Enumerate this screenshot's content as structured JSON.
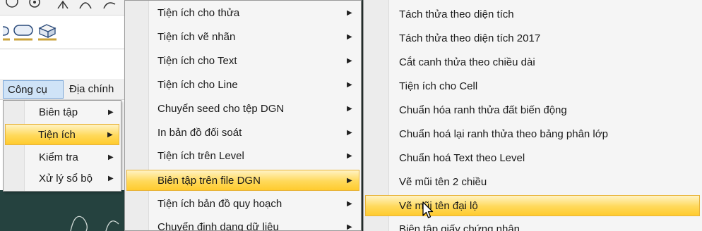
{
  "menubar": {
    "items": [
      {
        "label": "Công cụ"
      },
      {
        "label": "Địa chính"
      }
    ]
  },
  "menu_cong_cu": {
    "items": [
      {
        "label": "Biên tập",
        "has_submenu": true
      },
      {
        "label": "Tiện ích",
        "has_submenu": true,
        "highlighted": true
      },
      {
        "label": "Kiểm tra",
        "has_submenu": true
      },
      {
        "label": "Xử lý sổ bộ",
        "has_submenu": true
      }
    ]
  },
  "menu_tien_ich": {
    "items": [
      {
        "label": "Tiện ích cho thửa",
        "has_submenu": true
      },
      {
        "label": "Tiện ích vẽ nhãn",
        "has_submenu": true
      },
      {
        "label": "Tiện ích cho Text",
        "has_submenu": true
      },
      {
        "label": "Tiện ích cho Line",
        "has_submenu": true
      },
      {
        "label": "Chuyển seed cho tệp DGN",
        "has_submenu": true
      },
      {
        "label": "In bản đồ đối soát",
        "has_submenu": true
      },
      {
        "label": "Tiện ích trên Level",
        "has_submenu": true
      },
      {
        "label": "Biên tập trên file DGN",
        "has_submenu": true,
        "highlighted": true
      },
      {
        "label": "Tiện ích bản đồ quy hoạch",
        "has_submenu": true
      },
      {
        "label": "Chuyển định dạng dữ liệu",
        "has_submenu": true
      }
    ]
  },
  "menu_bien_tap_dgn": {
    "items": [
      {
        "label": "Tách thửa theo diện tích"
      },
      {
        "label": "Tách thửa theo diện tích 2017"
      },
      {
        "label": "Cắt canh thửa theo chiều dài"
      },
      {
        "label": "Tiện ích cho Cell"
      },
      {
        "label": "Chuẩn hóa ranh thửa đất biến động"
      },
      {
        "label": "Chuẩn hoá lại ranh thửa theo bảng phân lớp"
      },
      {
        "label": "Chuẩn hoá Text theo Level"
      },
      {
        "label": "Vẽ mũi tên 2 chiều"
      },
      {
        "label": "Vẽ mũi tên đại lộ",
        "highlighted": true
      },
      {
        "label": "Biên tập giấy chứng nhận"
      }
    ]
  },
  "icons": {
    "submenu_arrow": "▶"
  },
  "colors": {
    "highlight_top": "#fff3c4",
    "highlight_bottom": "#ffcb2e",
    "menubar_active": "#cfe3f7",
    "canvas_dark": "#25423f"
  }
}
